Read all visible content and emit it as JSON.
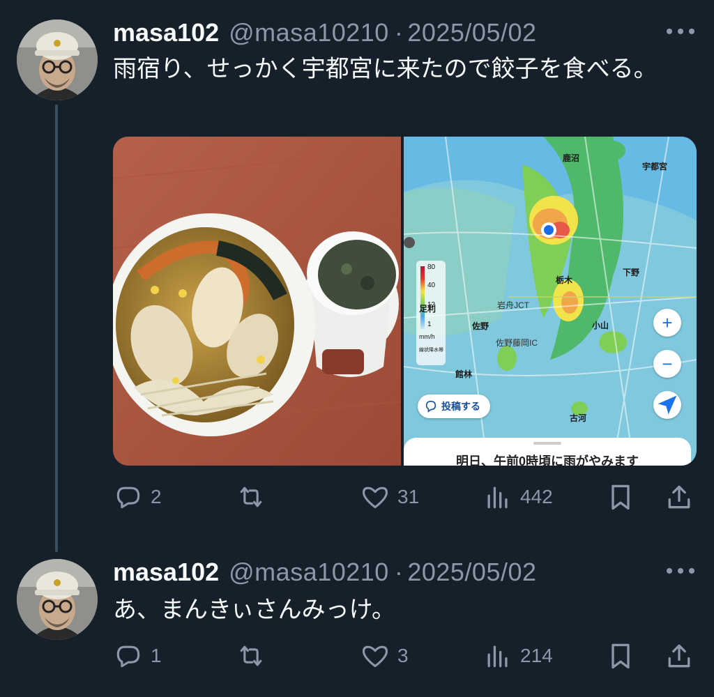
{
  "tweets": [
    {
      "name": "masa102",
      "handle": "@masa10210",
      "sep": "·",
      "date": "2025/05/02",
      "text": "雨宿り、せっかく宇都宮に来たので餃子を食べる。",
      "stats": {
        "replies": "2",
        "reposts": "",
        "likes": "31",
        "views": "442"
      },
      "media": {
        "map": {
          "places": [
            "鹿沼",
            "宇都宮",
            "栃木",
            "下野",
            "佐野",
            "小山",
            "館林",
            "古河",
            "岩舟JCT",
            "佐野藤岡IC",
            "足利"
          ],
          "legend": [
            "80",
            "40",
            "12",
            "1",
            "mm/h",
            "線状降水帯"
          ],
          "post_button": "投稿する",
          "sheet_text": "明日、午前0時頃に雨がやみます",
          "zoom_in": "+",
          "zoom_out": "−"
        }
      }
    },
    {
      "name": "masa102",
      "handle": "@masa10210",
      "sep": "·",
      "date": "2025/05/02",
      "text": "あ、まんきぃさんみっけ。",
      "stats": {
        "replies": "1",
        "reposts": "",
        "likes": "3",
        "views": "214"
      }
    }
  ],
  "icons": {
    "reply": "speech-bubble-icon",
    "repost": "repost-arrows-icon",
    "like": "heart-icon",
    "views": "bar-chart-icon",
    "bookmark": "bookmark-icon",
    "share": "share-upload-icon",
    "more": "more-dots-icon"
  },
  "colors": {
    "background": "#15202b",
    "muted": "#8b98a5",
    "text": "#f7f9f9",
    "thread": "#3d4f5f"
  }
}
